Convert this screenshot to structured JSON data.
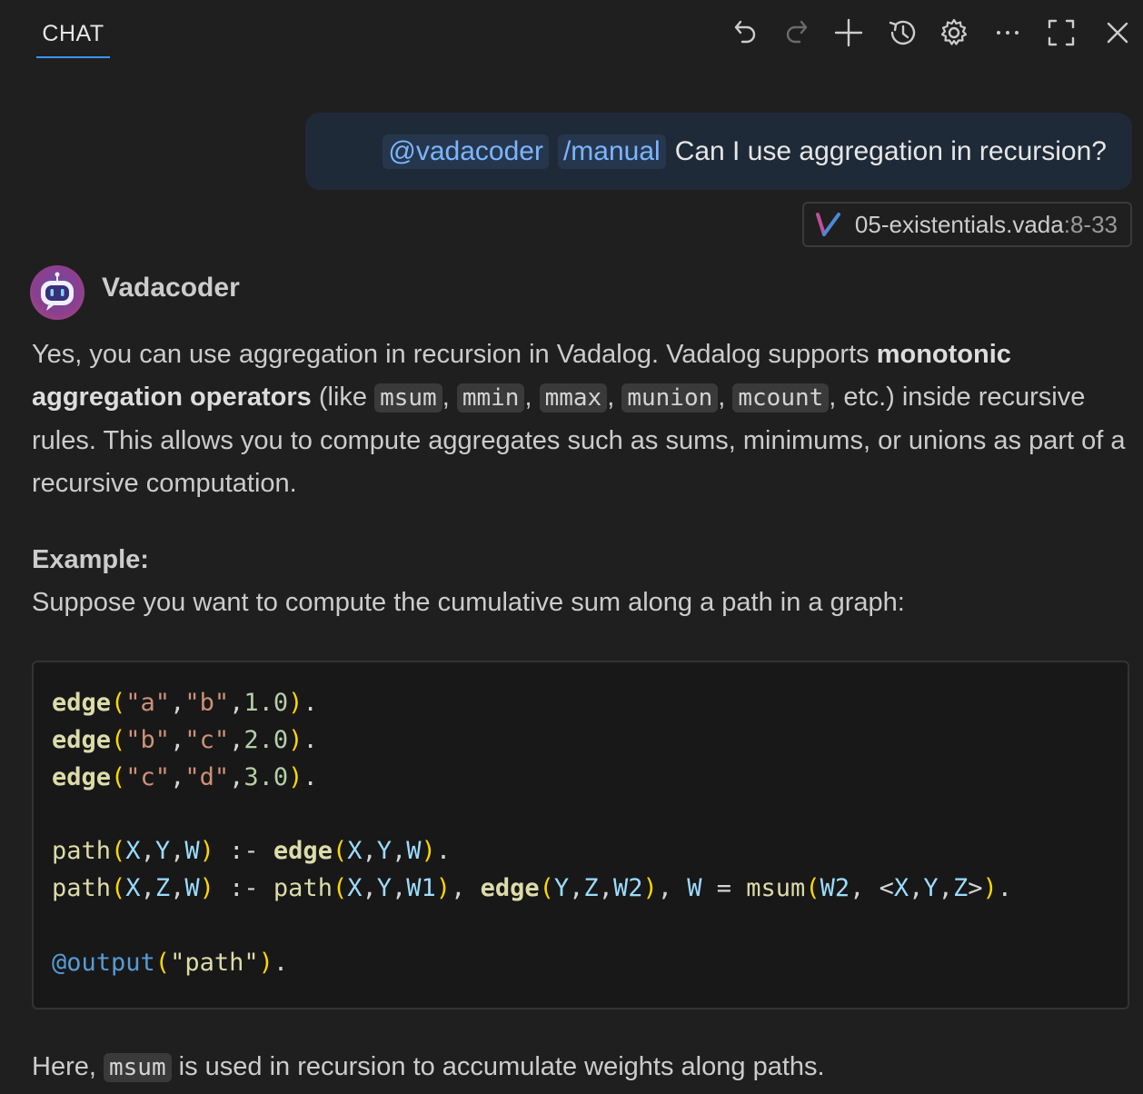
{
  "header": {
    "tab_label": "CHAT",
    "toolbar": [
      "undo-icon",
      "redo-icon",
      "plus-icon",
      "history-icon",
      "gear-icon",
      "more-icon",
      "maximize-icon",
      "close-icon"
    ]
  },
  "user_message": {
    "mention_agent": "@vadacoder",
    "mention_command": "/manual",
    "text": "Can I use aggregation in recursion?"
  },
  "attachment": {
    "filename": "05-existentials.vada",
    "range": ":8-33"
  },
  "agent": {
    "name": "Vadacoder"
  },
  "response": {
    "intro_start": "Yes, you can use aggregation in recursion in Vadalog. Vadalog supports ",
    "intro_bold": "monotonic aggregation operators",
    "intro_like": " (like ",
    "ops": [
      "msum",
      "mmin",
      "mmax",
      "munion",
      "mcount"
    ],
    "intro_end": ", etc.) inside recursive rules. This allows you to compute aggregates such as sums, minimums, or unions as part of a recursive computation.",
    "example_heading": "Example:",
    "example_text": "Suppose you want to compute the cumulative sum along a path in a graph:",
    "code_lines": [
      "edge(\"a\",\"b\",1.0).",
      "edge(\"b\",\"c\",2.0).",
      "edge(\"c\",\"d\",3.0).",
      "",
      "path(X,Y,W) :- edge(X,Y,W).",
      "path(X,Z,W) :- path(X,Y,W1), edge(Y,Z,W2), W = msum(W2, <X,Y,Z>).",
      "",
      "@output(\"path\")."
    ],
    "outro_start": "Here, ",
    "outro_code": "msum",
    "outro_end": " is used in recursion to accumulate weights along paths."
  },
  "colors": {
    "background": "#1f1f1f",
    "accent": "#3794ff",
    "mention": "#7cb5ff"
  }
}
